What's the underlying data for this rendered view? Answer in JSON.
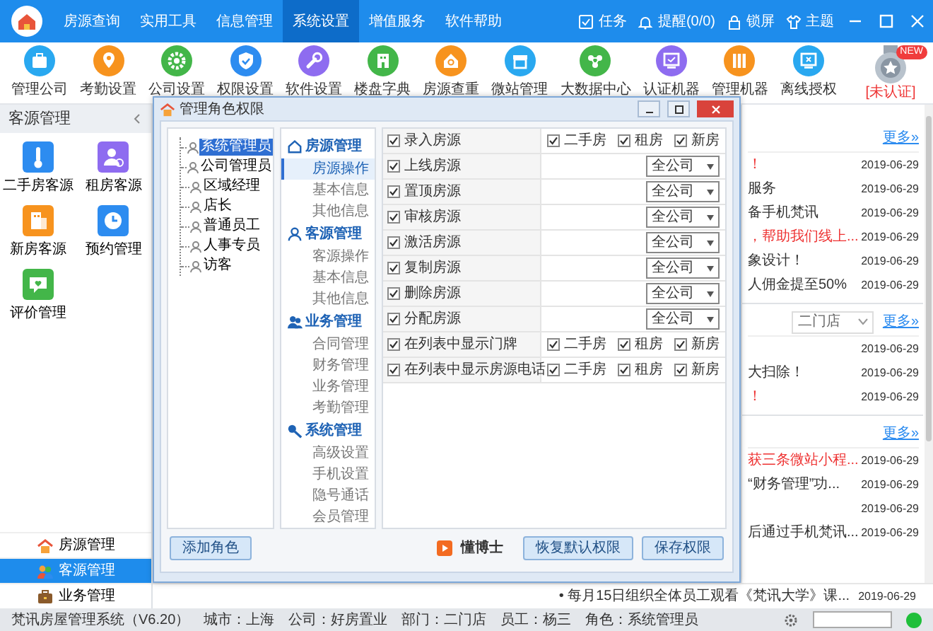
{
  "window": {
    "menu": [
      {
        "label": "房源查询",
        "selected": false
      },
      {
        "label": "实用工具",
        "selected": false
      },
      {
        "label": "信息管理",
        "selected": false
      },
      {
        "label": "系统设置",
        "selected": true
      },
      {
        "label": "增值服务",
        "selected": false
      },
      {
        "label": "软件帮助",
        "selected": false
      }
    ],
    "actions": [
      "任务",
      "提醒(0/0)",
      "锁屏",
      "主题"
    ]
  },
  "toolbar": [
    "管理公司",
    "考勤设置",
    "公司设置",
    "权限设置",
    "软件设置",
    "楼盘字典",
    "房源查重",
    "微站管理",
    "大数据中心",
    "认证机器",
    "管理机器",
    "离线授权"
  ],
  "certification": {
    "badge": "NEW",
    "label": "[未认证]"
  },
  "sidebar": {
    "title": "客源管理",
    "items": [
      "二手房客源",
      "租房客源",
      "新房客源",
      "预约管理",
      "评价管理"
    ],
    "bottom_nav": [
      {
        "label": "房源管理",
        "selected": false
      },
      {
        "label": "客源管理",
        "selected": true
      },
      {
        "label": "业务管理",
        "selected": false
      }
    ]
  },
  "dialog": {
    "title": "管理角色权限",
    "roles": [
      {
        "label": "系统管理员",
        "selected": true
      },
      {
        "label": "公司管理员",
        "selected": false
      },
      {
        "label": "区域经理",
        "selected": false
      },
      {
        "label": "店长",
        "selected": false
      },
      {
        "label": "普通员工",
        "selected": false
      },
      {
        "label": "人事专员",
        "selected": false
      },
      {
        "label": "访客",
        "selected": false
      }
    ],
    "modules": [
      {
        "label": "房源管理",
        "items": [
          {
            "label": "房源操作",
            "selected": true
          },
          {
            "label": "基本信息",
            "selected": false
          },
          {
            "label": "其他信息",
            "selected": false
          }
        ]
      },
      {
        "label": "客源管理",
        "items": [
          {
            "label": "客源操作",
            "selected": false
          },
          {
            "label": "基本信息",
            "selected": false
          },
          {
            "label": "其他信息",
            "selected": false
          }
        ]
      },
      {
        "label": "业务管理",
        "items": [
          {
            "label": "合同管理",
            "selected": false
          },
          {
            "label": "财务管理",
            "selected": false
          },
          {
            "label": "业务管理",
            "selected": false
          },
          {
            "label": "考勤管理",
            "selected": false
          }
        ]
      },
      {
        "label": "系统管理",
        "items": [
          {
            "label": "高级设置",
            "selected": false
          },
          {
            "label": "手机设置",
            "selected": false
          },
          {
            "label": "隐号通话",
            "selected": false
          },
          {
            "label": "会员管理",
            "selected": false
          }
        ]
      }
    ],
    "permissions": [
      {
        "kind": "types",
        "label": "录入房源",
        "checked": true,
        "options": [
          {
            "label": "二手房",
            "checked": true
          },
          {
            "label": "租房",
            "checked": true
          },
          {
            "label": "新房",
            "checked": true
          }
        ]
      },
      {
        "kind": "scope",
        "label": "上线房源",
        "checked": true,
        "scope": "全公司"
      },
      {
        "kind": "scope",
        "label": "置顶房源",
        "checked": true,
        "scope": "全公司"
      },
      {
        "kind": "scope",
        "label": "审核房源",
        "checked": true,
        "scope": "全公司"
      },
      {
        "kind": "scope",
        "label": "激活房源",
        "checked": true,
        "scope": "全公司"
      },
      {
        "kind": "scope",
        "label": "复制房源",
        "checked": true,
        "scope": "全公司"
      },
      {
        "kind": "scope",
        "label": "删除房源",
        "checked": true,
        "scope": "全公司"
      },
      {
        "kind": "scope",
        "label": "分配房源",
        "checked": true,
        "scope": "全公司"
      },
      {
        "kind": "types",
        "label": "在列表中显示门牌",
        "checked": true,
        "options": [
          {
            "label": "二手房",
            "checked": true
          },
          {
            "label": "租房",
            "checked": true
          },
          {
            "label": "新房",
            "checked": true
          }
        ]
      },
      {
        "kind": "types",
        "label": "在列表中显示房源电话",
        "checked": true,
        "options": [
          {
            "label": "二手房",
            "checked": true
          },
          {
            "label": "租房",
            "checked": true
          },
          {
            "label": "新房",
            "checked": true
          }
        ]
      }
    ],
    "add_button": "添加角色",
    "brand": "懂博士",
    "reset_button": "恢复默认权限",
    "save_button": "保存权限"
  },
  "news_panel": {
    "sections": [
      {
        "more": "更多»",
        "items": [
          {
            "text": "！",
            "highlighted": true,
            "date": "2019-06-29"
          },
          {
            "text": "服务",
            "highlighted": false,
            "date": "2019-06-29"
          },
          {
            "text": "备手机梵讯",
            "highlighted": false,
            "date": "2019-06-29"
          },
          {
            "text": "，帮助我们线上...",
            "highlighted": true,
            "date": "2019-06-29"
          },
          {
            "text": "象设计！",
            "highlighted": false,
            "date": "2019-06-29"
          },
          {
            "text": "人佣金提至50%",
            "highlighted": false,
            "date": "2019-06-29"
          }
        ]
      },
      {
        "store": "二门店",
        "more": "更多»",
        "items": [
          {
            "date": "2019-06-29"
          },
          {
            "text": "大扫除！",
            "highlighted": false,
            "date": "2019-06-29"
          },
          {
            "text": "！",
            "highlighted": true,
            "date": "2019-06-29"
          }
        ]
      },
      {
        "more": "更多»",
        "items": [
          {
            "text": "获三条微站小程...",
            "highlighted": true,
            "date": "2019-06-29"
          },
          {
            "text": "“财务管理”功...",
            "highlighted": false,
            "date": "2019-06-29"
          },
          {
            "date": "2019-06-29"
          },
          {
            "text": "后通过手机梵讯...",
            "highlighted": false,
            "date": "2019-06-29"
          }
        ]
      }
    ],
    "bottom_item": {
      "text": "• 每月15日组织全体员工观看《梵讯大学》课...",
      "date": "2019-06-29"
    }
  },
  "status_bar": {
    "fields": [
      "梵讯房屋管理系统（V6.20）",
      "城市：上海",
      "公司：好房置业",
      "部门：二门店",
      "员工：杨三",
      "角色：系统管理员"
    ]
  }
}
